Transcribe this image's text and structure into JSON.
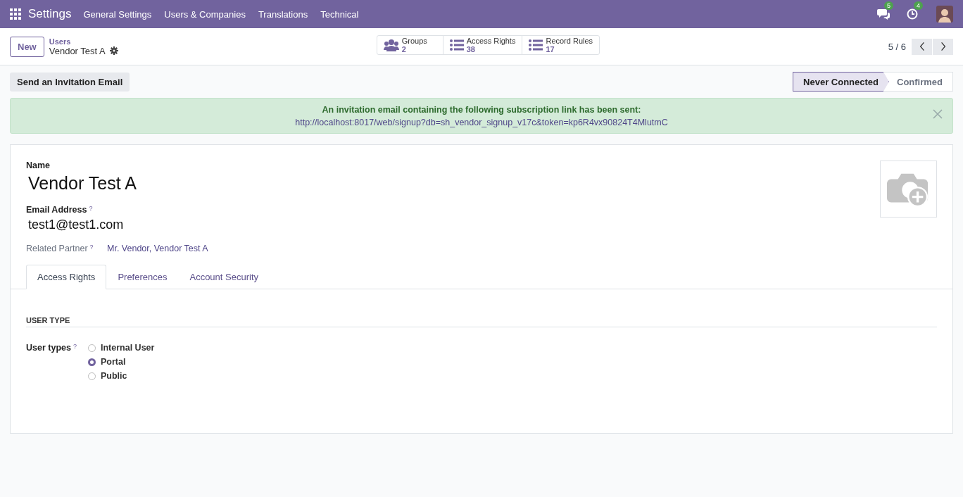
{
  "navbar": {
    "app_name": "Settings",
    "menus": [
      "General Settings",
      "Users & Companies",
      "Translations",
      "Technical"
    ],
    "messages_badge": "5",
    "activities_badge": "4"
  },
  "control_panel": {
    "new_button": "New",
    "breadcrumb_parent": "Users",
    "breadcrumb_current": "Vendor Test A",
    "smart_buttons": [
      {
        "kind": "groups",
        "label": "Groups",
        "count": "2"
      },
      {
        "kind": "list",
        "label": "Access Rights",
        "count": "38"
      },
      {
        "kind": "list",
        "label": "Record Rules",
        "count": "17"
      }
    ],
    "pager": "5 / 6"
  },
  "status_bar": {
    "action_button": "Send an Invitation Email",
    "stages": [
      {
        "label": "Never Connected",
        "selected": true
      },
      {
        "label": "Confirmed",
        "selected": false
      }
    ]
  },
  "alert": {
    "message": "An invitation email containing the following subscription link has been sent:",
    "link": "http://localhost:8017/web/signup?db=sh_vendor_signup_v17c&token=kp6R4vx90824T4MlutmC"
  },
  "form": {
    "name_label": "Name",
    "name": "Vendor Test A",
    "email_label": "Email Address",
    "email_help": "?",
    "email": "test1@test1.com",
    "partner_label": "Related Partner",
    "partner_help": "?",
    "partner": "Mr. Vendor, Vendor Test A",
    "tabs": [
      {
        "label": "Access Rights",
        "selected": true
      },
      {
        "label": "Preferences",
        "selected": false
      },
      {
        "label": "Account Security",
        "selected": false
      }
    ],
    "section_title": "USER TYPE",
    "user_types_label": "User types",
    "user_types_help": "?",
    "options": [
      {
        "label": "Internal User",
        "selected": false
      },
      {
        "label": "Portal",
        "selected": true
      },
      {
        "label": "Public",
        "selected": false
      }
    ]
  }
}
